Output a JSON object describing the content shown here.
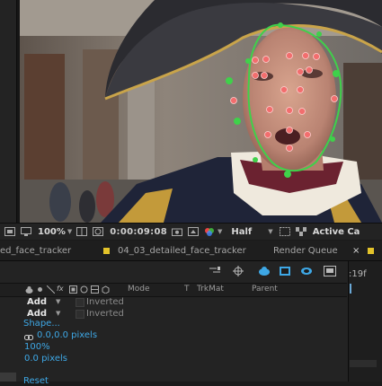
{
  "viewer": {
    "zoom": "100%",
    "timecode": "0:00:09:08",
    "resolution": "Half",
    "camera": "Active Ca"
  },
  "tabs": [
    {
      "label": "ed_face_tracker",
      "color": "#e3c32a"
    },
    {
      "label": "04_03_detailed_face_tracker",
      "color": "#e3c32a"
    },
    {
      "label": "Render Queue",
      "color": ""
    },
    {
      "label": "",
      "color": "#e3c32a"
    }
  ],
  "timeline": {
    "frame_readout": ":19f",
    "columns": {
      "mode": "Mode",
      "t": "T",
      "trkmat": "TrkMat",
      "parent": "Parent"
    },
    "masks": [
      {
        "mode": "Add",
        "inverted_label": "Inverted"
      },
      {
        "mode": "Add",
        "inverted_label": "Inverted"
      }
    ],
    "properties": {
      "shape": "Shape...",
      "feather": "0.0,0.0 pixels",
      "opacity": "100%",
      "expansion": "0.0 pixels",
      "reset": "Reset"
    }
  },
  "colors": {
    "mask_path": "#3fd14a",
    "track_point": "#f26e6e",
    "link_value": "#3ea8e6",
    "tab_marker": "#e3c32a"
  }
}
